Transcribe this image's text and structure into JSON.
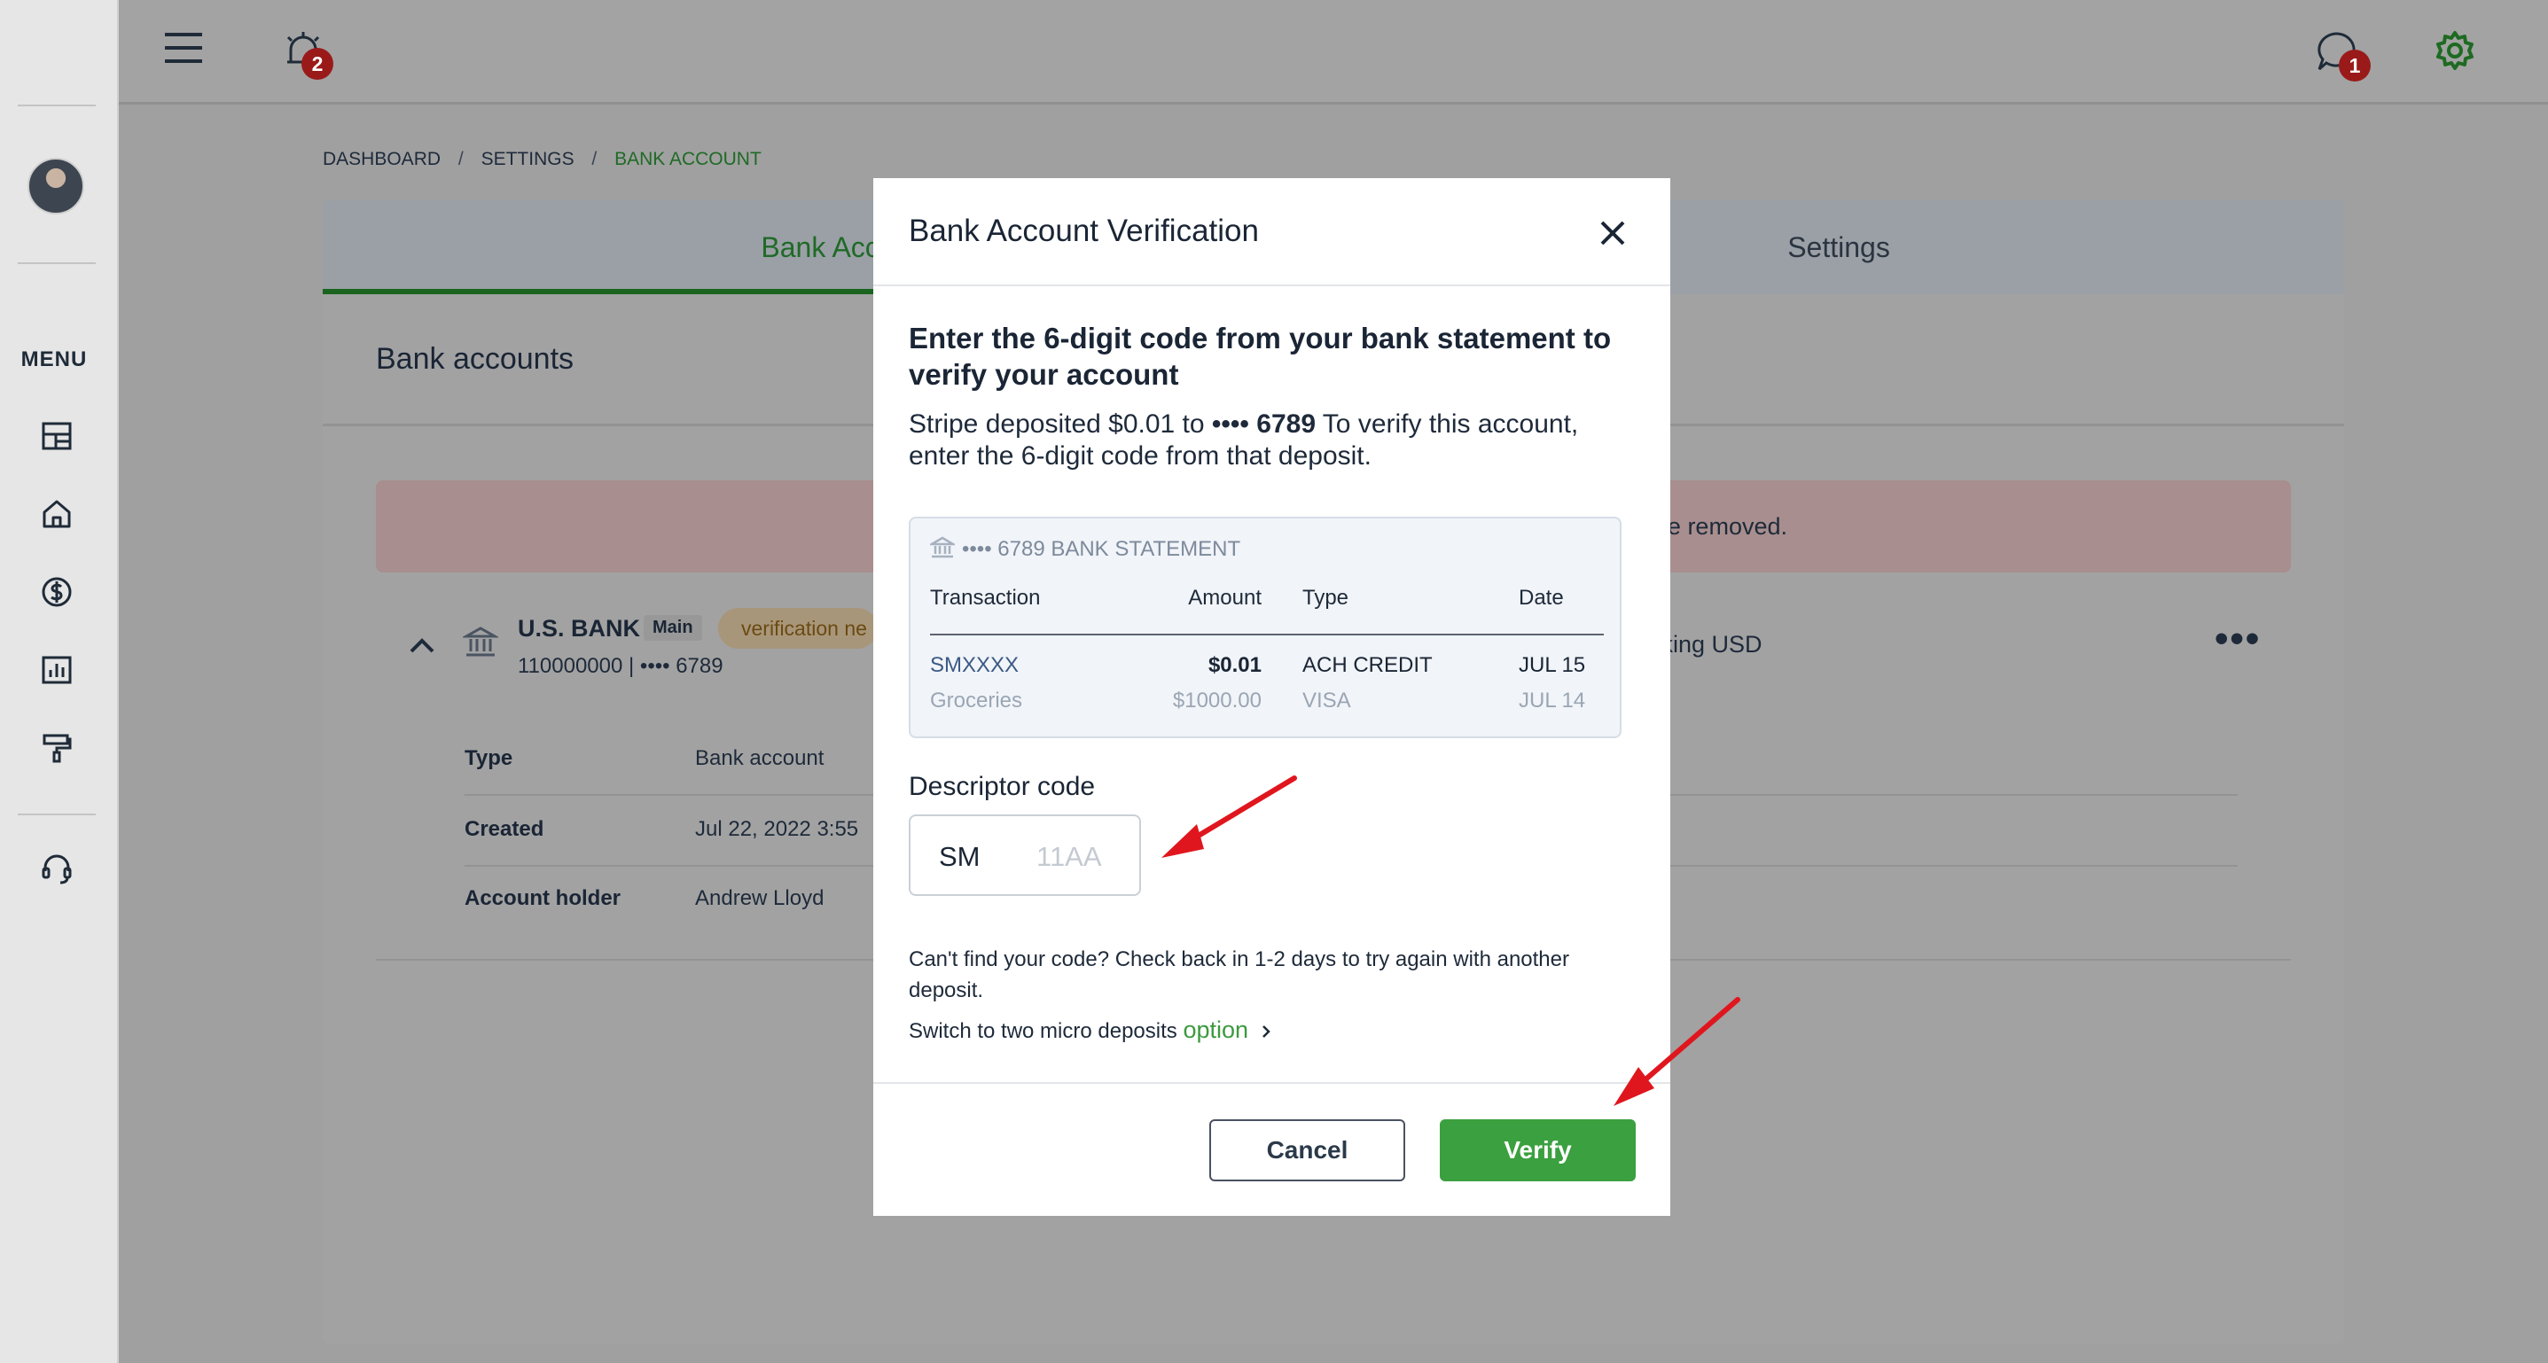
{
  "sidebar": {
    "menu_label": "MENU",
    "icons": [
      "dashboard-icon",
      "home-icon",
      "dollar-icon",
      "reports-icon",
      "paint-roller-icon",
      "support-headset-icon"
    ]
  },
  "topbar": {
    "alarm_badge": "2",
    "chat_badge": "1",
    "accent_color": "#3ba03f"
  },
  "breadcrumb": {
    "items": [
      "DASHBOARD",
      "SETTINGS",
      "BANK ACCOUNT"
    ],
    "separator": "/"
  },
  "tabs": {
    "bank_accounts": "Bank Acco",
    "settings": "Settings"
  },
  "page": {
    "card_title": "Bank accounts",
    "alert_text": "e removed.",
    "bank": {
      "name": "U.S. BANK",
      "tag": "Main",
      "status": "verification ne",
      "account": "110000000 | •••• 6789",
      "meta": "cking   USD"
    },
    "details": [
      {
        "label": "Type",
        "value": "Bank account"
      },
      {
        "label": "Created",
        "value": "Jul 22, 2022 3:55"
      },
      {
        "label": "Account holder",
        "value": "Andrew Lloyd"
      }
    ]
  },
  "modal": {
    "title": "Bank Account Verification",
    "heading": "Enter the 6-digit code from your bank statement to verify your account",
    "desc_pre": "Stripe deposited $0.01 to ",
    "desc_bold": "•••• 6789",
    "desc_post": " To verify this account, enter the 6-digit code from that deposit.",
    "statement": {
      "header": "•••• 6789 BANK STATEMENT",
      "columns": [
        "Transaction",
        "Amount",
        "Type",
        "Date"
      ],
      "rows": [
        {
          "transaction": "SMXXXX",
          "amount": "$0.01",
          "type": "ACH CREDIT",
          "date": "JUL 15"
        },
        {
          "transaction": "Groceries",
          "amount": "$1000.00",
          "type": "VISA",
          "date": "JUL 14"
        }
      ]
    },
    "descriptor_label": "Descriptor code",
    "descriptor_prefix": "SM",
    "descriptor_placeholder": "11AA",
    "help_text": "Can't find your code? Check back in 1-2 days to try again with another deposit.",
    "switch_text": "Switch to two micro deposits ",
    "switch_link": "option",
    "cancel_label": "Cancel",
    "verify_label": "Verify",
    "verify_color": "#3ba03f",
    "annotation_color": "#e0161e"
  }
}
